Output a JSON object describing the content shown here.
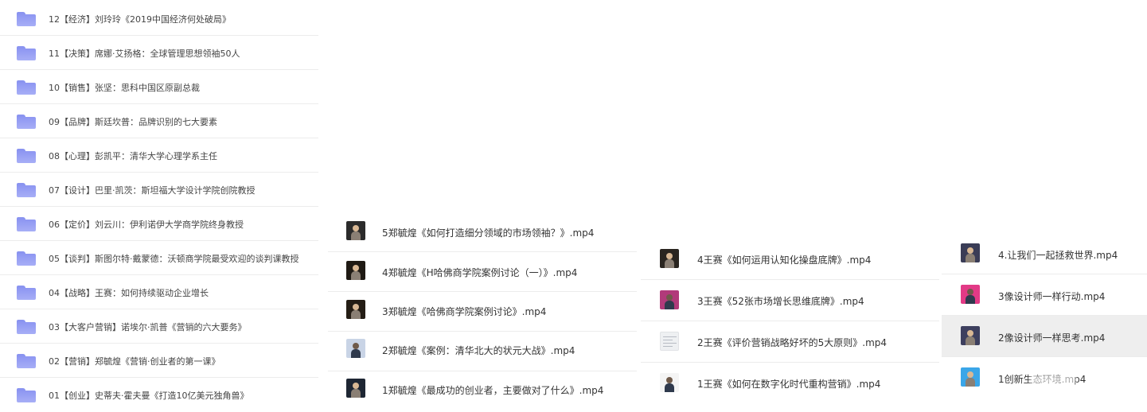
{
  "folders": [
    {
      "label": "12【经济】刘玲玲《2019中国经济何处破局》"
    },
    {
      "label": "11【决策】席娜·艾扬格：全球管理思想领袖50人"
    },
    {
      "label": "10【销售】张坚：思科中国区原副总裁"
    },
    {
      "label": "09【品牌】斯廷坎普：品牌识别的七大要素"
    },
    {
      "label": "08【心理】彭凯平：清华大学心理学系主任"
    },
    {
      "label": "07【设计】巴里·凯茨：斯坦福大学设计学院创院教授"
    },
    {
      "label": "06【定价】刘云川：伊利诺伊大学商学院终身教授"
    },
    {
      "label": "05【谈判】斯图尔特·戴蒙德：沃顿商学院最受欢迎的谈判课教授"
    },
    {
      "label": "04【战略】王赛：如何持续驱动企业增长"
    },
    {
      "label": "03【大客户营销】诺埃尔·凯普《营销的六大要务》"
    },
    {
      "label": "02【营销】郑毓煌《营销·创业者的第一课》"
    },
    {
      "label": "01【创业】史蒂夫·霍夫曼《打造10亿美元独角兽》"
    }
  ],
  "list_zheng": [
    {
      "label": "5郑毓煌《如何打造细分领域的市场领袖？》.mp4",
      "thumb_icon": "video-thumbnail-icon",
      "thumb_color": "#2b2b2b"
    },
    {
      "label": "4郑毓煌《H哈佛商学院案例讨论（一）》.mp4",
      "thumb_icon": "video-thumbnail-icon",
      "thumb_color": "#1f1a14"
    },
    {
      "label": "3郑毓煌《哈佛商学院案例讨论》.mp4",
      "thumb_icon": "video-thumbnail-icon",
      "thumb_color": "#241d15"
    },
    {
      "label": "2郑毓煌《案例：清华北大的状元大战》.mp4",
      "thumb_icon": "video-thumbnail-icon",
      "thumb_color": "#c9d4e6"
    },
    {
      "label": "1郑毓煌《最成功的创业者，主要做对了什么》.mp4",
      "thumb_icon": "video-thumbnail-icon",
      "thumb_color": "#1e2633"
    }
  ],
  "list_wang": [
    {
      "label": "4王赛《如何运用认知化操盘底牌》.mp4",
      "thumb_icon": "video-thumbnail-icon",
      "thumb_color": "#2a2520"
    },
    {
      "label": "3王赛《52张市场增长思维底牌》.mp4",
      "thumb_icon": "video-thumbnail-icon",
      "thumb_color": "#b13a7a"
    },
    {
      "label": "2王赛《评价营销战略好坏的5大原则》.mp4",
      "thumb_icon": "document-thumbnail-icon",
      "thumb_color": "#eef0f2"
    },
    {
      "label": "1王赛《如何在数字化时代重构营销》.mp4",
      "thumb_icon": "video-thumbnail-icon",
      "thumb_color": "#f4f4f4"
    }
  ],
  "list_design": [
    {
      "label": "4.让我们一起拯救世界.mp4",
      "thumb_icon": "video-thumbnail-icon",
      "thumb_color": "#3a3c56",
      "selected": false
    },
    {
      "label": "3像设计师一样行动.mp4",
      "thumb_icon": "video-thumbnail-icon",
      "thumb_color": "#e23a86",
      "selected": false
    },
    {
      "label": "2像设计师一样思考.mp4",
      "thumb_icon": "video-thumbnail-icon",
      "thumb_color": "#3d3f5e",
      "selected": true
    },
    {
      "label": "1创新生态环境.mp4",
      "thumb_icon": "video-thumbnail-icon",
      "thumb_color": "#3aa6e8",
      "selected": false
    }
  ],
  "colors": {
    "folder": "#8d96f2",
    "selected_row": "#eeeeee",
    "divider": "#ececec"
  }
}
